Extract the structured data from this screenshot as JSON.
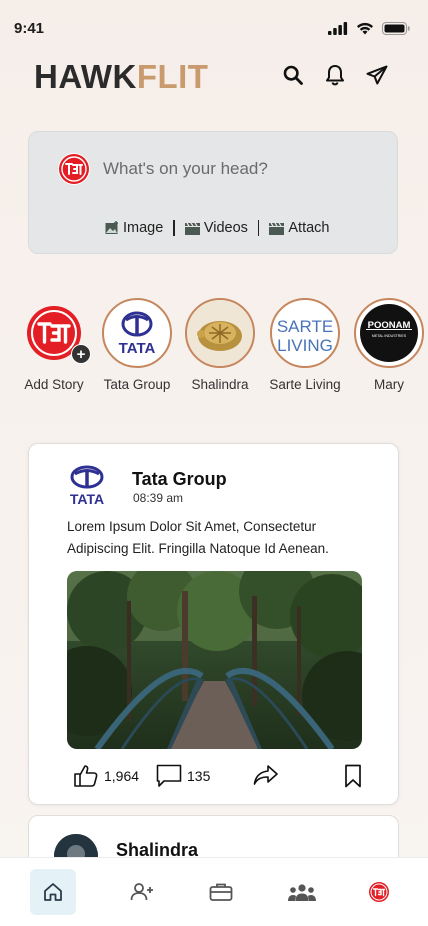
{
  "status": {
    "time": "9:41"
  },
  "header": {
    "logo_part1": "HAWK",
    "logo_part2": "FLIT",
    "icons": [
      "search-icon",
      "bell-icon",
      "send-icon"
    ]
  },
  "composer": {
    "placeholder": "What's on your head?",
    "actions": [
      {
        "label": "Image",
        "icon": "image-icon"
      },
      {
        "label": "Videos",
        "icon": "video-icon"
      },
      {
        "label": "Attach",
        "icon": "attach-icon"
      }
    ]
  },
  "stories": [
    {
      "label": "Add Story"
    },
    {
      "label": "Tata Group"
    },
    {
      "label": "Shalindra"
    },
    {
      "label": "Sarte Living"
    },
    {
      "label": "Mary"
    }
  ],
  "story_logos": {
    "tata": "TATA",
    "sarte_line1": "SARTE",
    "sarte_line2": "LIVING",
    "poonam": "POONAM",
    "poonam_sub": "METAL INDUSTRIES"
  },
  "post": {
    "author": "Tata Group",
    "author_logo": "TATA",
    "time": "08:39 am",
    "text": "Lorem Ipsum Dolor Sit Amet, Consectetur Adipiscing Elit. Fringilla Natoque Id Aenean.",
    "likes": "1,964",
    "comments": "135"
  },
  "post2": {
    "author": "Shalindra"
  },
  "nav": [
    "home-icon",
    "add-friend-icon",
    "briefcase-icon",
    "groups-icon",
    "profile-icon"
  ],
  "colors": {
    "accent": "#c99a6e",
    "brand_red": "#e31e24",
    "tata_blue": "#2e3192",
    "ring": "#c6865d"
  }
}
